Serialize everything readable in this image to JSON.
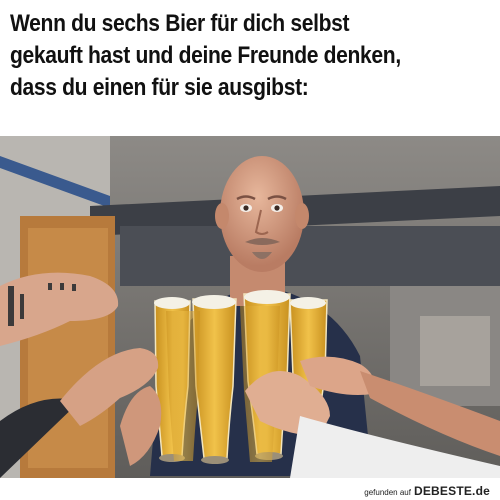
{
  "meme": {
    "caption_lines": [
      "Wenn du sechs Bier für dich selbst",
      "gekauft hast und deine Freunde denken,",
      "dass du einen für sie ausgibst:"
    ]
  },
  "footer": {
    "found_on": "gefunden auf",
    "brand": "DEBESTE.de"
  },
  "colors": {
    "beer": "#e9b63a",
    "foam": "#f4f1e6",
    "shirt": "#26304a"
  }
}
